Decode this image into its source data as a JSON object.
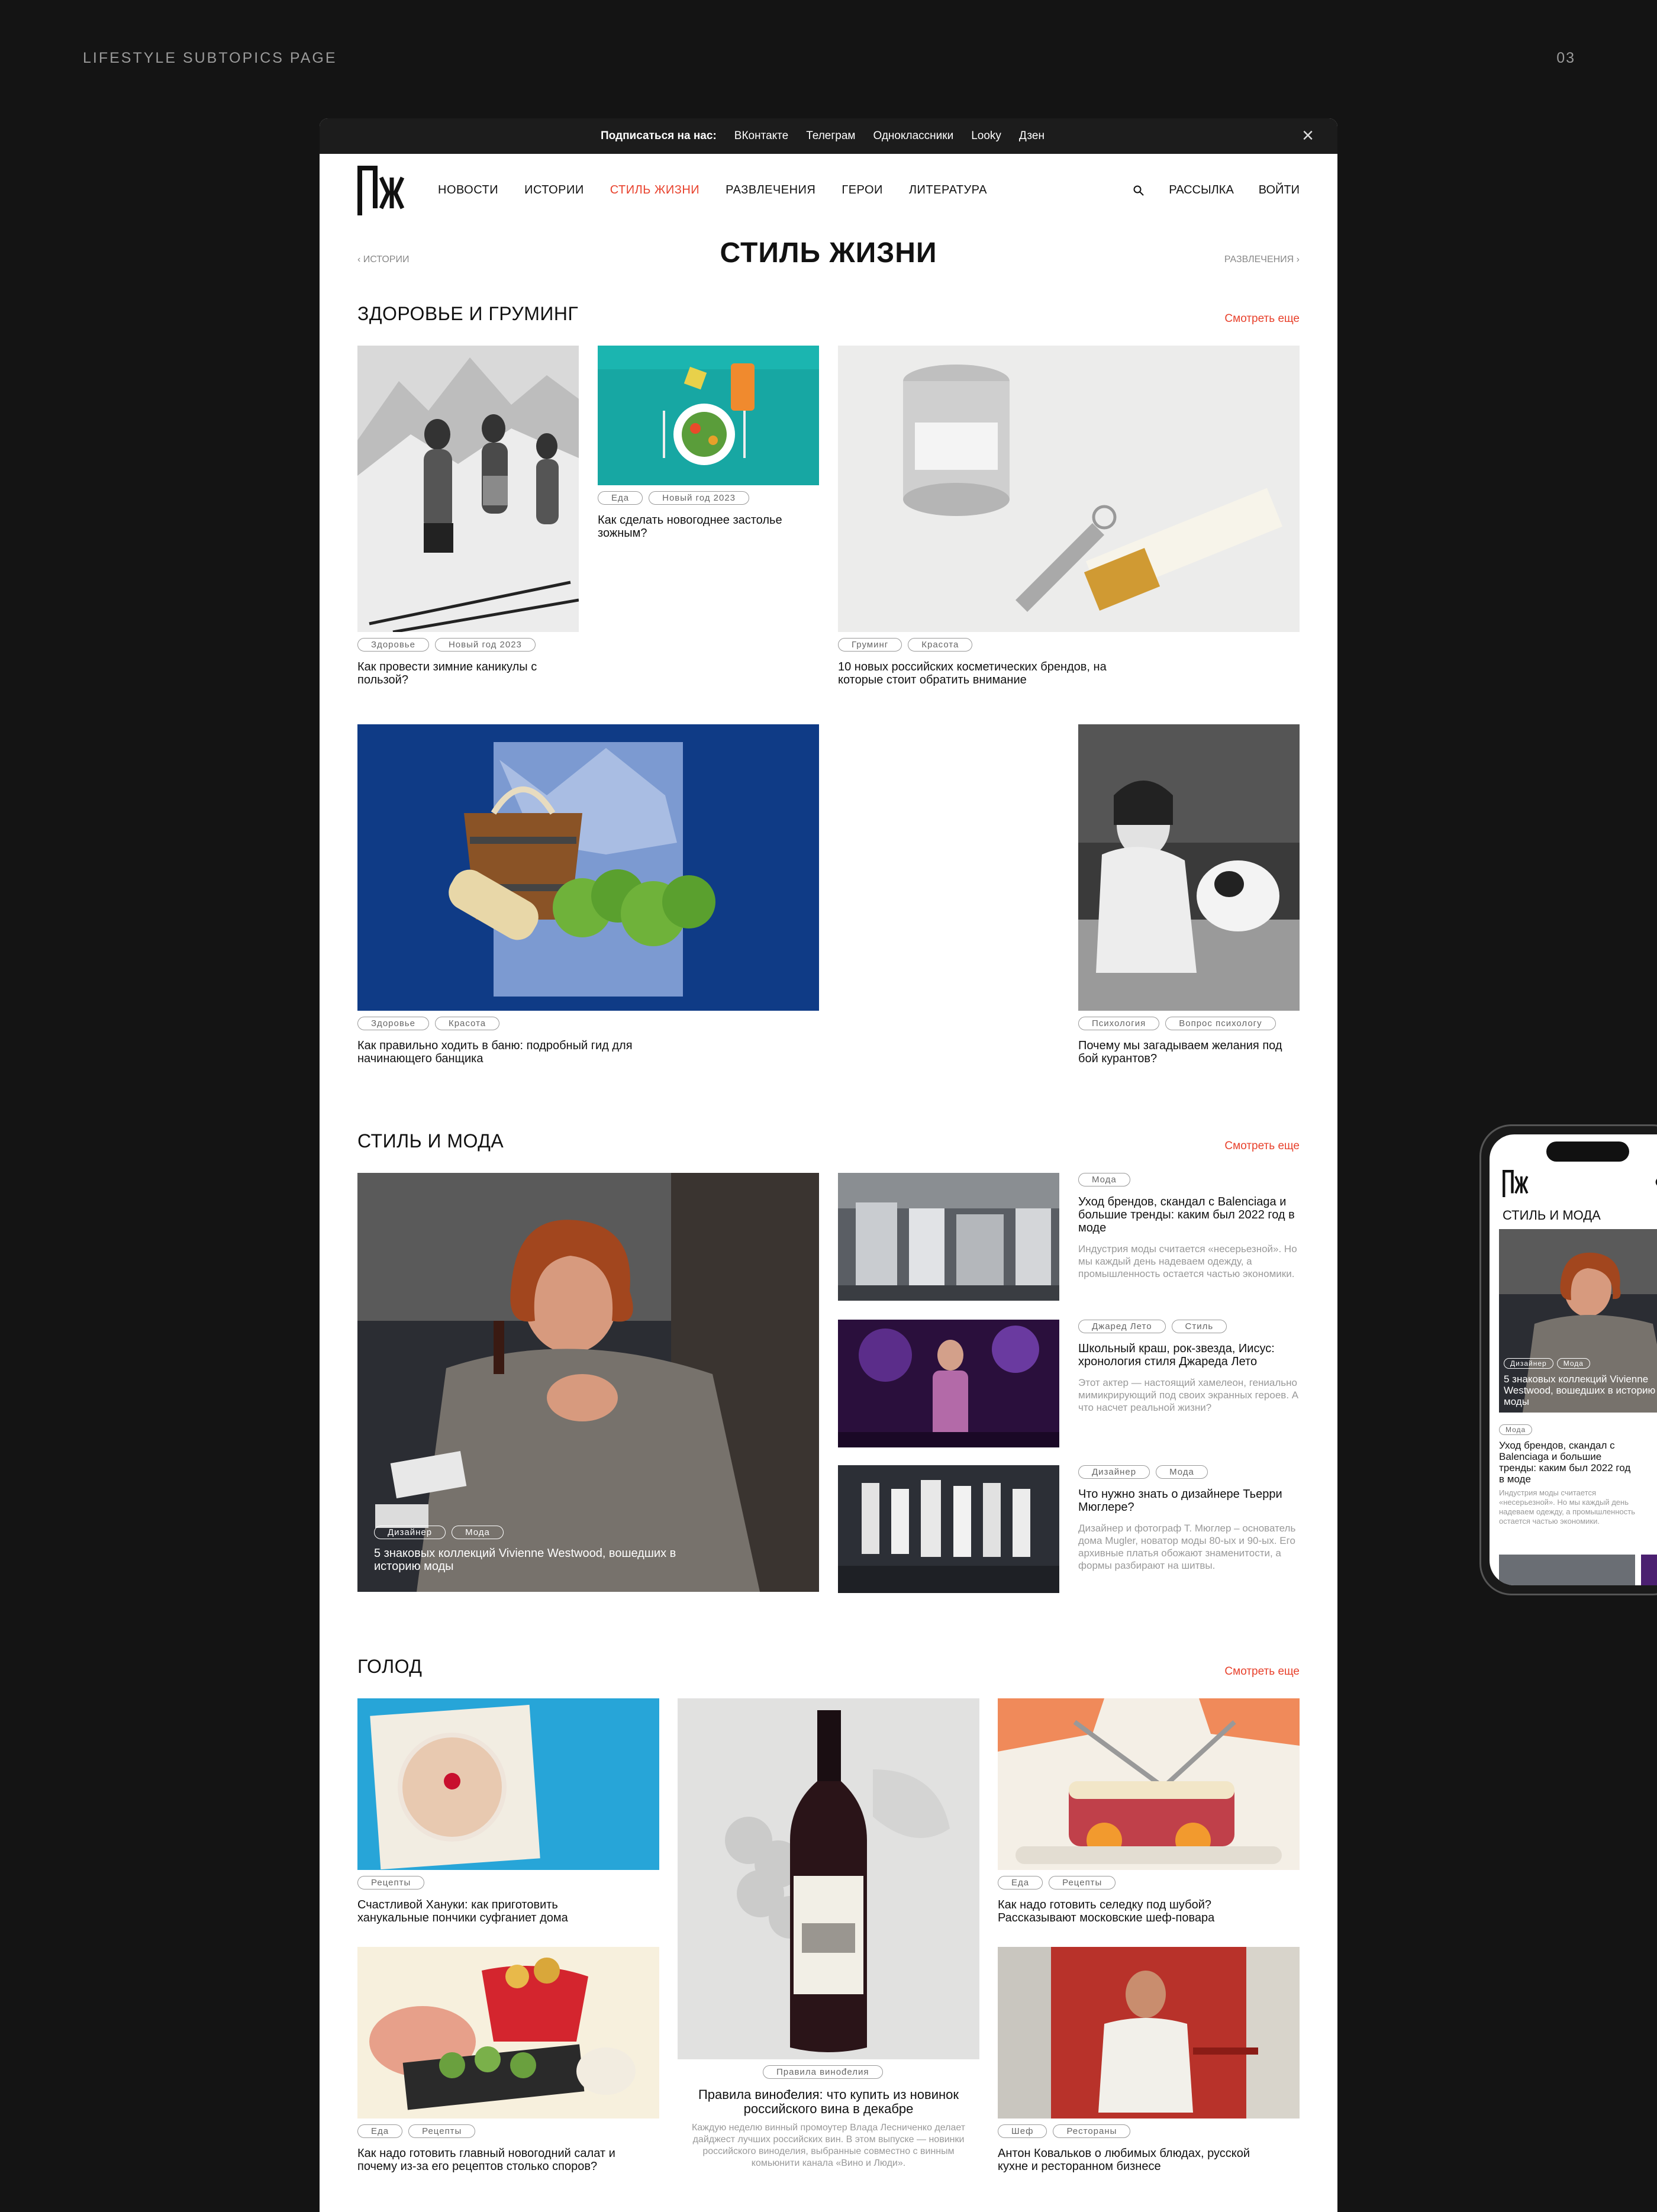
{
  "page_label": "LIFESTYLE SUBTOPICS PAGE",
  "page_number": "03",
  "topbar": {
    "subscribe": "Подписаться на нас:",
    "links": [
      "ВКонтакте",
      "Телеграм",
      "Одноклассники",
      "Looky",
      "Дзен"
    ]
  },
  "header": {
    "nav": [
      "НОВОСТИ",
      "ИСТОРИИ",
      "СТИЛЬ ЖИЗНИ",
      "РАЗВЛЕЧЕНИЯ",
      "ГЕРОИ",
      "ЛИТЕРАТУРА"
    ],
    "newsletter": "РАССЫЛКА",
    "login": "ВОЙТИ"
  },
  "breadcrumb": {
    "prev": "‹ ИСТОРИИ",
    "next": "РАЗВЛЕЧЕНИЯ ›"
  },
  "title": "СТИЛЬ ЖИЗНИ",
  "see_more": "Смотреть еще",
  "health": {
    "title": "ЗДОРОВЬЕ И ГРУМИНГ",
    "cards": [
      {
        "tags": [
          "Здоровье",
          "Новый год 2023"
        ],
        "title": "Как провести зимние каникулы с пользой?"
      },
      {
        "tags": [
          "Еда",
          "Новый год 2023"
        ],
        "title": "Как сделать новогоднее застолье зожным?"
      },
      {
        "tags": [
          "Груминг",
          "Красота"
        ],
        "title": "10 новых российских косметических брендов, на которые стоит обратить внимание"
      },
      {
        "tags": [
          "Здоровье",
          "Красота"
        ],
        "title": "Как правильно ходить в баню: подробный гид для начинающего банщика"
      },
      {
        "tags": [
          "Психология",
          "Вопрос психологу"
        ],
        "title": "Почему мы загадываем желания под бой курантов?"
      }
    ]
  },
  "fashion": {
    "title": "СТИЛЬ И МОДА",
    "main": {
      "tags": [
        "Дизайнер",
        "Мода"
      ],
      "title": "5 знаковых коллекций Vivienne Westwood, вошедших в историю моды"
    },
    "items": [
      {
        "tags": [
          "Мода"
        ],
        "title": "Уход брендов, скандал с Balenciaga и большие тренды: каким был 2022 год в моде",
        "desc": "Индустрия моды считается «несерьезной». Но мы каждый день надеваем одежду, а промышленность остается частью экономики."
      },
      {
        "tags": [
          "Джаред Лето",
          "Стиль"
        ],
        "title": "Школьный краш, рок-звезда, Иисус: хронология стиля Джареда Лето",
        "desc": "Этот актер — настоящий хамелеон, гениально мимикрирующий под своих экранных героев. А что насчет реальной жизни?"
      },
      {
        "tags": [
          "Дизайнер",
          "Мода"
        ],
        "title": "Что нужно знать о дизайнере Тьерри Мюглере?",
        "desc": "Дизайнер и фотограф Т. Мюглер – основатель дома Mugler, новатор моды 80-ых и 90-ых. Его архивные платья обожают знаменитости, а формы разбирают на шитвы."
      }
    ]
  },
  "food": {
    "title": "ГОЛОД",
    "cards": [
      {
        "tags": [
          "Рецепты"
        ],
        "title": "Счастливой Хануки: как приготовить ханукальные пончики суфганиет дома"
      },
      {
        "tags": [
          "Правила винođелия"
        ],
        "title": "Правила винođелия: что купить из новинок российского вина в декабре",
        "desc": "Каждую неделю винный промоутер Влада Лесниченко делает дайджест лучших российских вин. В этом выпуске — новинки российского виноделия, выбранные совместно с винным комьюнити канала «Вино и Люди»."
      },
      {
        "tags": [
          "Еда",
          "Рецепты"
        ],
        "title": "Как надо готовить селедку под шубой? Рассказывают московские шеф-повара"
      },
      {
        "tags": [
          "Еда",
          "Рецепты"
        ],
        "title": "Как надо готовить главный новогодний салат и почему из-за его рецептов столько споров?"
      },
      {
        "tags": [
          "Шеф",
          "Рестораны"
        ],
        "title": "Антон Ковальков о любимых блюдах, русской кухне и ресторанном бизнесе"
      }
    ]
  },
  "mobile": {
    "section": "СТИЛЬ И МОДА",
    "main_tags": [
      "Дизайнер",
      "Мода"
    ],
    "main_title": "5 знаковых коллекций Vivienne Westwood, вошедших в историю моды",
    "item_tag": "Мода",
    "item_title": "Уход брендов, скандал с Balenciaga и большие тренды: каким был 2022 год в моде",
    "item_desc": "Индустрия моды считается «несерьезной». Но мы каждый день надеваем одежду, а промышленность остается частью экономики."
  }
}
